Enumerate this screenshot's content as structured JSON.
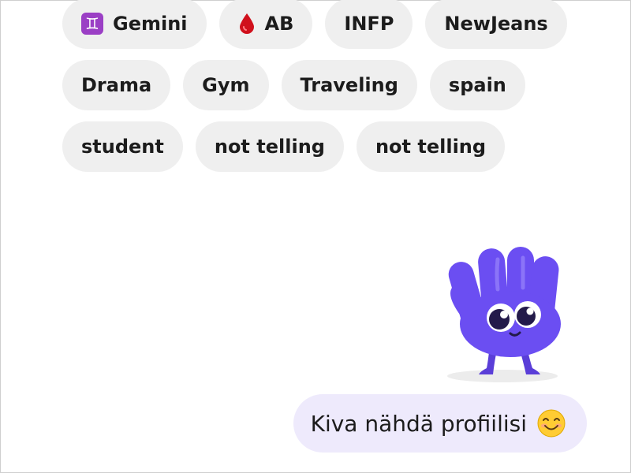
{
  "tags": [
    [
      {
        "label": "Gemini",
        "icon": "gemini-zodiac-icon",
        "icon_color": "#9b3fc5"
      },
      {
        "label": "AB",
        "icon": "blood-drop-icon",
        "icon_color": "#d0101c"
      },
      {
        "label": "INFP"
      },
      {
        "label": "NewJeans"
      }
    ],
    [
      {
        "label": "Drama"
      },
      {
        "label": "Gym"
      },
      {
        "label": "Traveling"
      },
      {
        "label": "spain"
      }
    ],
    [
      {
        "label": "student"
      },
      {
        "label": "not telling"
      },
      {
        "label": "not telling"
      }
    ]
  ],
  "message": {
    "text": "Kiva nähdä profiilisi",
    "emoji": "smiling-face-icon",
    "bubble_color": "#eeeafc"
  },
  "mascot": {
    "icon": "waving-hand-mascot-icon",
    "color": "#6b4ef2"
  }
}
